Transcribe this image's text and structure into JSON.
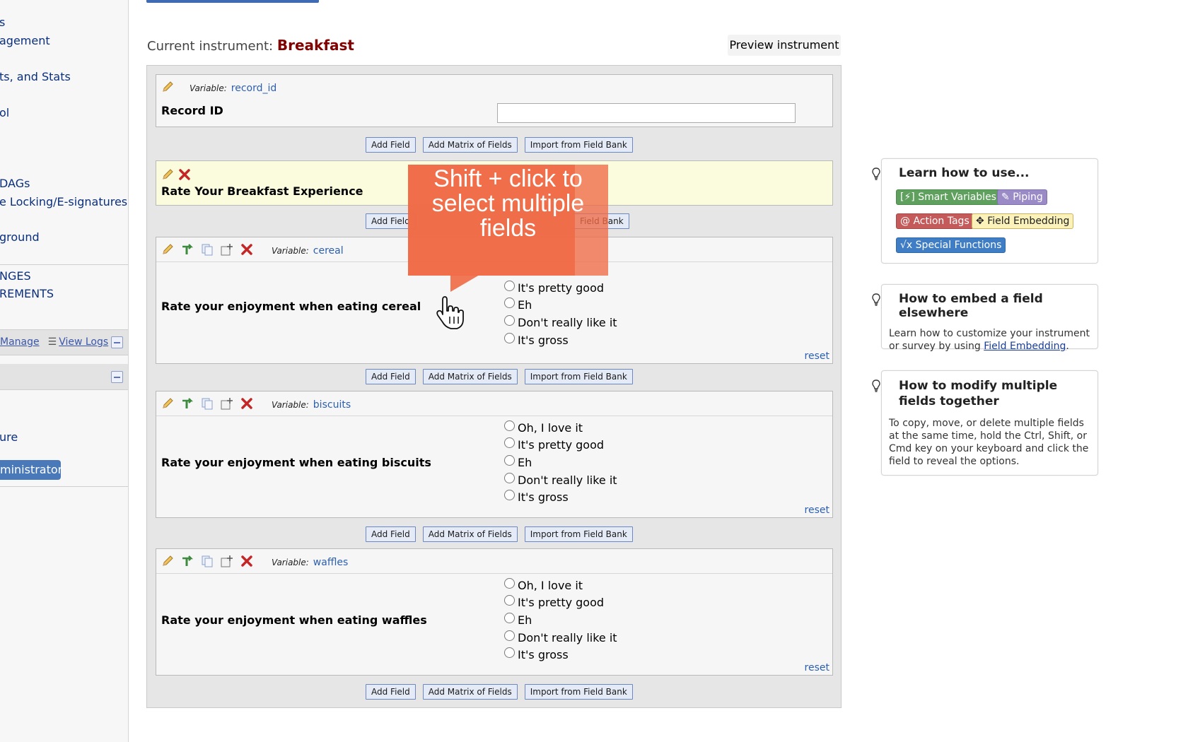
{
  "sidebar": {
    "links": [
      "s",
      "agement",
      "ts, and Stats",
      "ol",
      "DAGs",
      "e Locking/E-signatures",
      "ground",
      "NGES",
      "REMENTS",
      "ure"
    ],
    "manage_label": "Manage",
    "view_logs_label": "View Logs",
    "admin_button": "ministrator"
  },
  "header": {
    "current_label": "Current instrument:",
    "instrument_name": "Breakfast",
    "preview_button": "Preview instrument"
  },
  "variable_prefix": "Variable:",
  "buttons": {
    "add_field": "Add Field",
    "add_matrix": "Add Matrix of Fields",
    "import_bank": "Import from Field Bank",
    "reset": "reset"
  },
  "fields": [
    {
      "variable": "record_id",
      "label": "Record ID"
    },
    {
      "label": "Rate Your Breakfast Experience"
    },
    {
      "variable": "cereal",
      "label": "Rate your enjoyment when eating cereal",
      "choices": [
        "It's pretty good",
        "Eh",
        "Don't really like it",
        "It's gross"
      ]
    },
    {
      "variable": "biscuits",
      "label": "Rate your enjoyment when eating biscuits",
      "choices": [
        "Oh, I love it",
        "It's pretty good",
        "Eh",
        "Don't really like it",
        "It's gross"
      ]
    },
    {
      "variable": "waffles",
      "label": "Rate your enjoyment when eating waffles",
      "choices": [
        "Oh, I love it",
        "It's pretty good",
        "Eh",
        "Don't really like it",
        "It's gross"
      ]
    }
  ],
  "partial_buttons": {
    "add_field_cut": "Add Field",
    "bank_cut": "Field Bank"
  },
  "tooltip": "Shift + click to select multiple fields",
  "help": {
    "learn_title": "Learn how to use...",
    "badges": {
      "smart_variables": "[⚡] Smart Variables",
      "piping": "Piping",
      "action_tags": "@ Action Tags",
      "field_embedding": "Field Embedding",
      "special_functions": "Special Functions"
    },
    "embed_title": "How to embed a field elsewhere",
    "embed_text": "Learn how to customize your instrument or survey by using",
    "embed_link": "Field Embedding",
    "embed_end": ".",
    "modify_title": "How to modify multiple fields together",
    "modify_text": "To copy, move, or delete multiple fields at the same time, hold the Ctrl, Shift, or Cmd key on your keyboard and click the field to reveal the options."
  },
  "colors": {
    "instrument_name": "#800000",
    "accent_blue": "#3e6bb3",
    "tooltip": "#f06a46"
  }
}
